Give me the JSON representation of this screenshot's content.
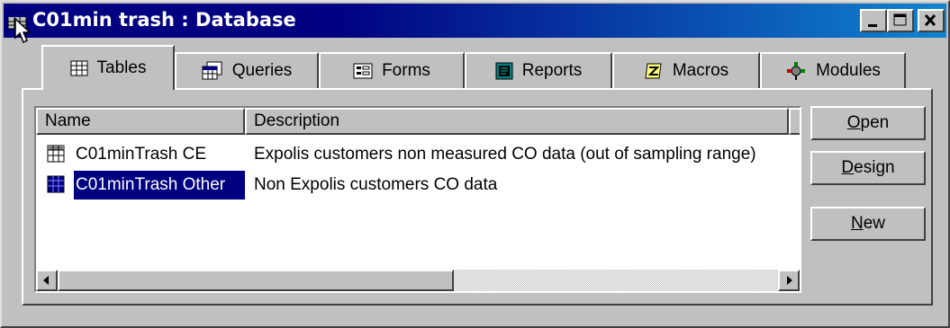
{
  "window": {
    "title": "C01min trash : Database"
  },
  "tabs": [
    {
      "label": "Tables",
      "icon": "table-icon",
      "active": true
    },
    {
      "label": "Queries",
      "icon": "query-icon"
    },
    {
      "label": "Forms",
      "icon": "form-icon"
    },
    {
      "label": "Reports",
      "icon": "report-icon"
    },
    {
      "label": "Macros",
      "icon": "macro-icon"
    },
    {
      "label": "Modules",
      "icon": "module-icon"
    }
  ],
  "list": {
    "columns": [
      "Name",
      "Description"
    ],
    "rows": [
      {
        "name": "C01minTrash CE",
        "description": "Expolis customers non measured CO data (out of sampling range)",
        "selected": false
      },
      {
        "name": "C01minTrash Other",
        "description": "Non Expolis customers CO data",
        "selected": true
      }
    ]
  },
  "buttons": {
    "open": {
      "mnemonic": "O",
      "rest": "pen"
    },
    "design": {
      "mnemonic": "D",
      "rest": "esign"
    },
    "new": {
      "mnemonic": "N",
      "rest": "ew"
    }
  },
  "colors": {
    "titlebar": "#000080",
    "selection": "#000080",
    "face": "#c0c0c0"
  }
}
